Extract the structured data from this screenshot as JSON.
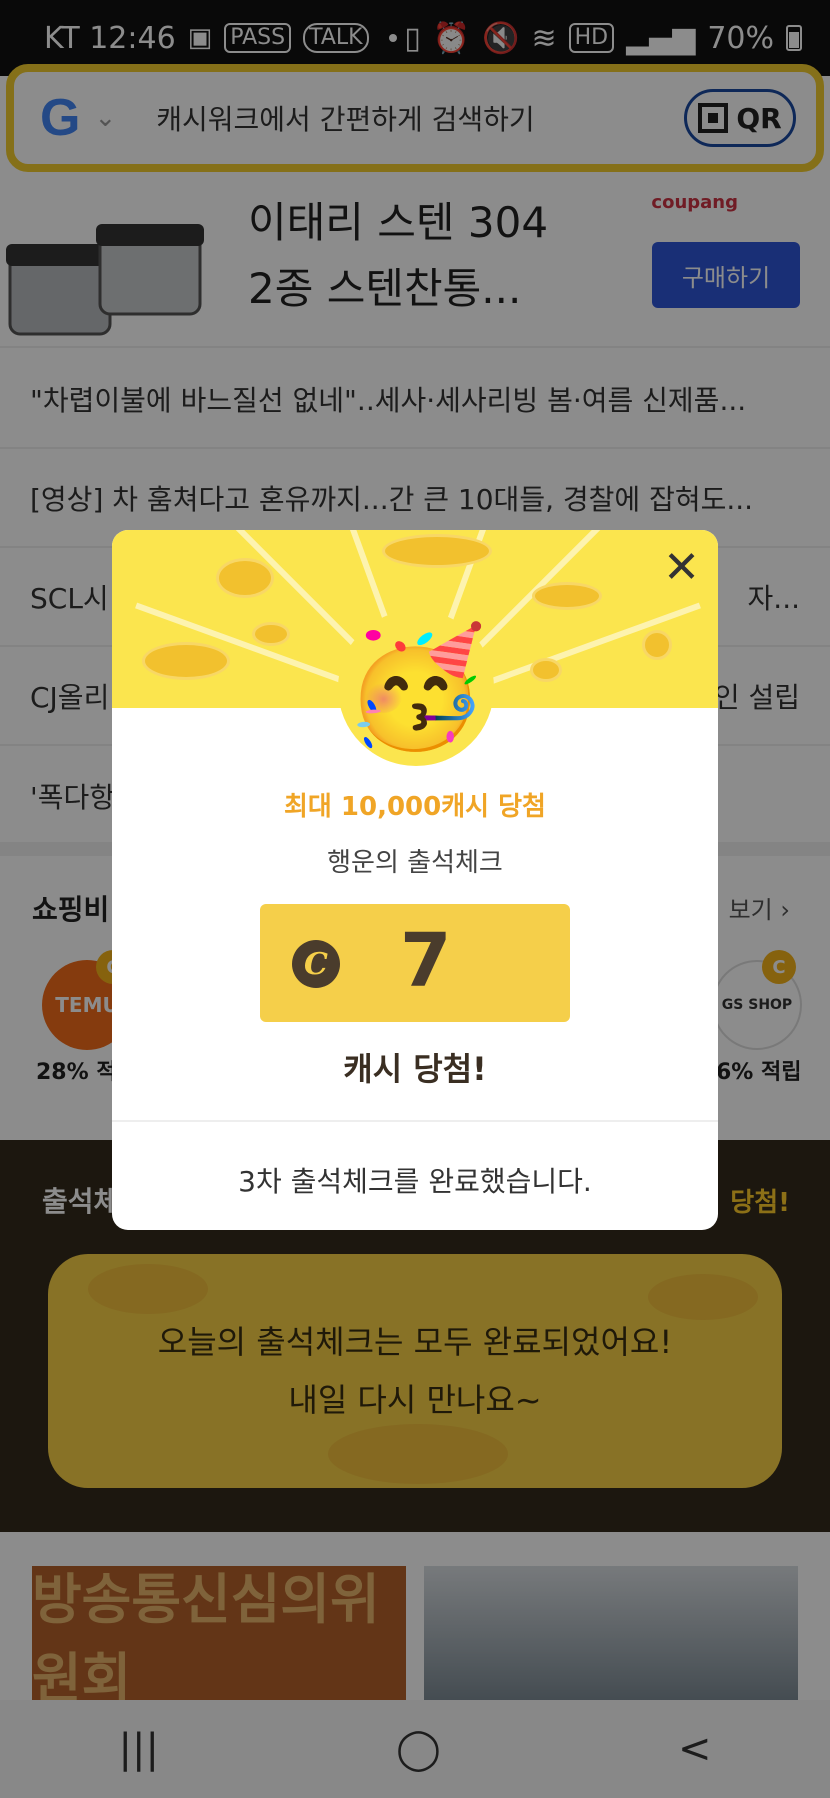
{
  "status_bar": {
    "carrier_time": "KT 12:46",
    "icons_left": [
      "image-icon",
      "PASS",
      "TALK"
    ],
    "icons_right": [
      "battery-saver-icon",
      "alarm-icon",
      "mute-icon",
      "wifi-icon",
      "hd-icon",
      "signal-icon"
    ],
    "pass_label": "PASS",
    "talk_label": "TALK",
    "hd_label": "HD",
    "battery": "70%"
  },
  "search": {
    "engine_logo": "G",
    "placeholder": "캐시워크에서 간편하게 검색하기",
    "qr_label": "QR"
  },
  "ad": {
    "title_line1": "이태리 스텐 304",
    "title_line2": "2종 스텐찬통...",
    "brand": "coupang",
    "buy_label": "구매하기"
  },
  "news": [
    {
      "text": "\"차렵이불에 바느질선 없네\"..세사·세사리빙 봄·여름 신제품...",
      "suffix": ""
    },
    {
      "text": "[영상] 차 훔쳐다고 혼유까지...간 큰 10대들, 경찰에 잡혀도...",
      "suffix": ""
    },
    {
      "text": "SCL시",
      "suffix": "자..."
    },
    {
      "text": "CJ올리",
      "suffix": "인 설립"
    },
    {
      "text": "'폭다항",
      "suffix": ""
    }
  ],
  "shopping": {
    "title": "쇼핑비",
    "more": "보기",
    "stores": [
      {
        "logo": "TEMU",
        "rate": "28% 적"
      },
      {
        "logo": "GS SHOP",
        "rate": "6% 적립"
      }
    ],
    "badge": "C"
  },
  "attendance": {
    "title": "출석체",
    "win_label": "당첨!",
    "card_line1": "오늘의 출석체크는 모두 완료되었어요!",
    "card_line2": "내일 다시 만나요~"
  },
  "thumbnails": {
    "thumb1_text": "방송통신심의위원회"
  },
  "modal": {
    "close_icon": "close-icon",
    "emoji": "🥳",
    "max_prize": "최대 10,000캐시 당첨",
    "subtitle": "행운의 출석체크",
    "coin_symbol": "C",
    "amount": "7",
    "win_text": "캐시 당첨!",
    "message": "3차 출석체크를 완료했습니다."
  },
  "nav": {
    "recent": "|||",
    "home": "◯",
    "back": "<"
  }
}
